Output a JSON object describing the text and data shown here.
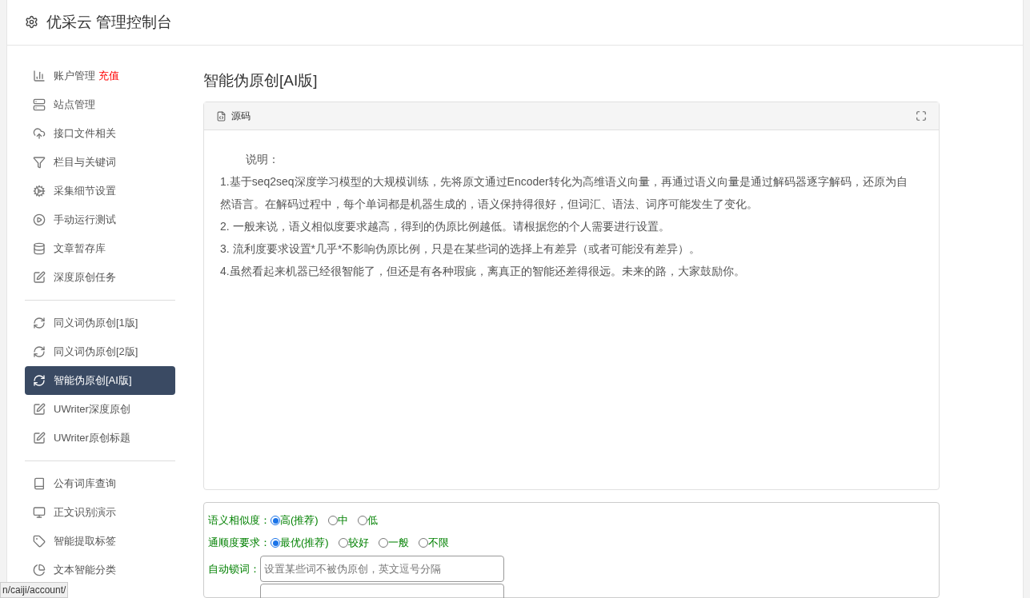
{
  "header": {
    "title": "优采云 管理控制台"
  },
  "sidebar": {
    "groups": [
      {
        "items": [
          {
            "kind": "chart",
            "label": "账户管理",
            "badge": "充值",
            "selected": false
          },
          {
            "kind": "server",
            "label": "站点管理",
            "selected": false
          },
          {
            "kind": "cloud",
            "label": "接口文件相关",
            "selected": false
          },
          {
            "kind": "filter",
            "label": "栏目与关键词",
            "selected": false
          },
          {
            "kind": "cogs",
            "label": "采集细节设置",
            "selected": false
          },
          {
            "kind": "play",
            "label": "手动运行测试",
            "selected": false
          },
          {
            "kind": "database",
            "label": "文章暂存库",
            "selected": false
          },
          {
            "kind": "edit",
            "label": "深度原创任务",
            "selected": false
          }
        ]
      },
      {
        "items": [
          {
            "kind": "refresh",
            "label": "同义词伪原创[1版]",
            "selected": false
          },
          {
            "kind": "refresh",
            "label": "同义词伪原创[2版]",
            "selected": false
          },
          {
            "kind": "refresh",
            "label": "智能伪原创[AI版]",
            "selected": true
          },
          {
            "kind": "edit",
            "label": "UWriter深度原创",
            "selected": false
          },
          {
            "kind": "edit",
            "label": "UWriter原创标题",
            "selected": false
          }
        ]
      },
      {
        "items": [
          {
            "kind": "book",
            "label": "公有词库查询",
            "selected": false
          },
          {
            "kind": "monitor",
            "label": "正文识别演示",
            "selected": false
          },
          {
            "kind": "tag",
            "label": "智能提取标签",
            "selected": false
          },
          {
            "kind": "pie",
            "label": "文本智能分类",
            "selected": false
          }
        ]
      }
    ]
  },
  "page_title": "智能伪原创[AI版]",
  "panel": {
    "title": "源码",
    "intro": "说明：",
    "paragraphs": [
      "1.基于seq2seq深度学习模型的大规模训练，先将原文通过Encoder转化为高维语义向量，再通过语义向量是通过解码器逐字解码，还原为自然语言。在解码过程中，每个单词都是机器生成的，语义保持得很好，但词汇、语法、词序可能发生了变化。",
      "2. 一般来说，语义相似度要求越高，得到的伪原比例越低。请根据您的个人需要进行设置。",
      "3. 流利度要求设置*几乎*不影响伪原比例，只是在某些词的选择上有差异（或者可能没有差异）。",
      "4.虽然看起来机器已经很智能了，但还是有各种瑕疵，离真正的智能还差得很远。未来的路，大家鼓励你。"
    ]
  },
  "form": {
    "radio_groups": [
      {
        "label": "语义相似度：",
        "options": [
          {
            "label": "高(推荐)",
            "selected": true
          },
          {
            "label": "中",
            "selected": false
          },
          {
            "label": "低",
            "selected": false
          }
        ]
      },
      {
        "label": "通顺度要求：",
        "options": [
          {
            "label": "最优(推荐)",
            "selected": true
          },
          {
            "label": "较好",
            "selected": false
          },
          {
            "label": "一般",
            "selected": false
          },
          {
            "label": "不限",
            "selected": false
          }
        ]
      }
    ],
    "lock_words": {
      "label": "自动锁词：",
      "placeholder": "设置某些词不被伪原创，英文逗号分隔"
    }
  },
  "status_bar": {
    "url": "n/caiji/account/"
  }
}
